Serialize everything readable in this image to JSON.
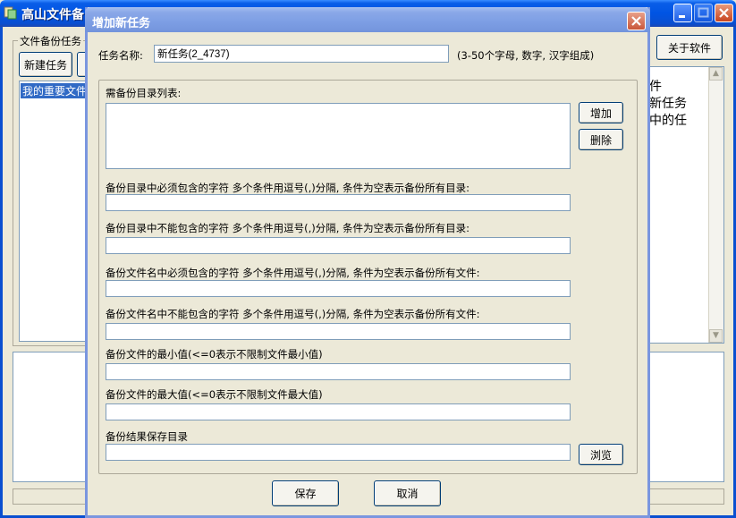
{
  "main_window": {
    "title": "高山文件备",
    "group_label": "文件备份任务",
    "new_task_label": "新建任务",
    "task_items": [
      "我的重要文件"
    ],
    "about_label": "关于软件",
    "help_lines": [
      "件",
      "新任务",
      "中的任"
    ]
  },
  "dialog": {
    "title": "增加新任务",
    "task_name": {
      "label": "任务名称:",
      "value": "新任务(2_4737)",
      "hint": "(3-50个字母, 数字, 汉字组成)"
    },
    "dirs_label": "需备份目录列表:",
    "add_label": "增加",
    "delete_label": "删除",
    "fields": [
      {
        "label": "备份目录中必须包含的字符  多个条件用逗号(,)分隔, 条件为空表示备份所有目录:",
        "value": ""
      },
      {
        "label": "备份目录中不能包含的字符  多个条件用逗号(,)分隔, 条件为空表示备份所有目录:",
        "value": ""
      },
      {
        "label": "备份文件名中必须包含的字符  多个条件用逗号(,)分隔, 条件为空表示备份所有文件:",
        "value": ""
      },
      {
        "label": "备份文件名中不能包含的字符  多个条件用逗号(,)分隔, 条件为空表示备份所有文件:",
        "value": ""
      },
      {
        "label": "备份文件的最小值(<=0表示不限制文件最小值)",
        "value": ""
      },
      {
        "label": "备份文件的最大值(<=0表示不限制文件最大值)",
        "value": ""
      },
      {
        "label": "备份结果保存目录",
        "value": ""
      }
    ],
    "browse_label": "浏览",
    "save_label": "保存",
    "cancel_label": "取消",
    "close_glyph": "✕"
  },
  "icons": {
    "minimize": "minimize-icon",
    "maximize": "maximize-icon",
    "close": "close-icon",
    "scroll_up": "chevron-up-icon",
    "scroll_down": "chevron-down-icon"
  },
  "colors": {
    "face": "#ece9d8",
    "selection": "#316ac5",
    "title_active": "#0054e3",
    "title_inactive": "#7d9ee4"
  }
}
